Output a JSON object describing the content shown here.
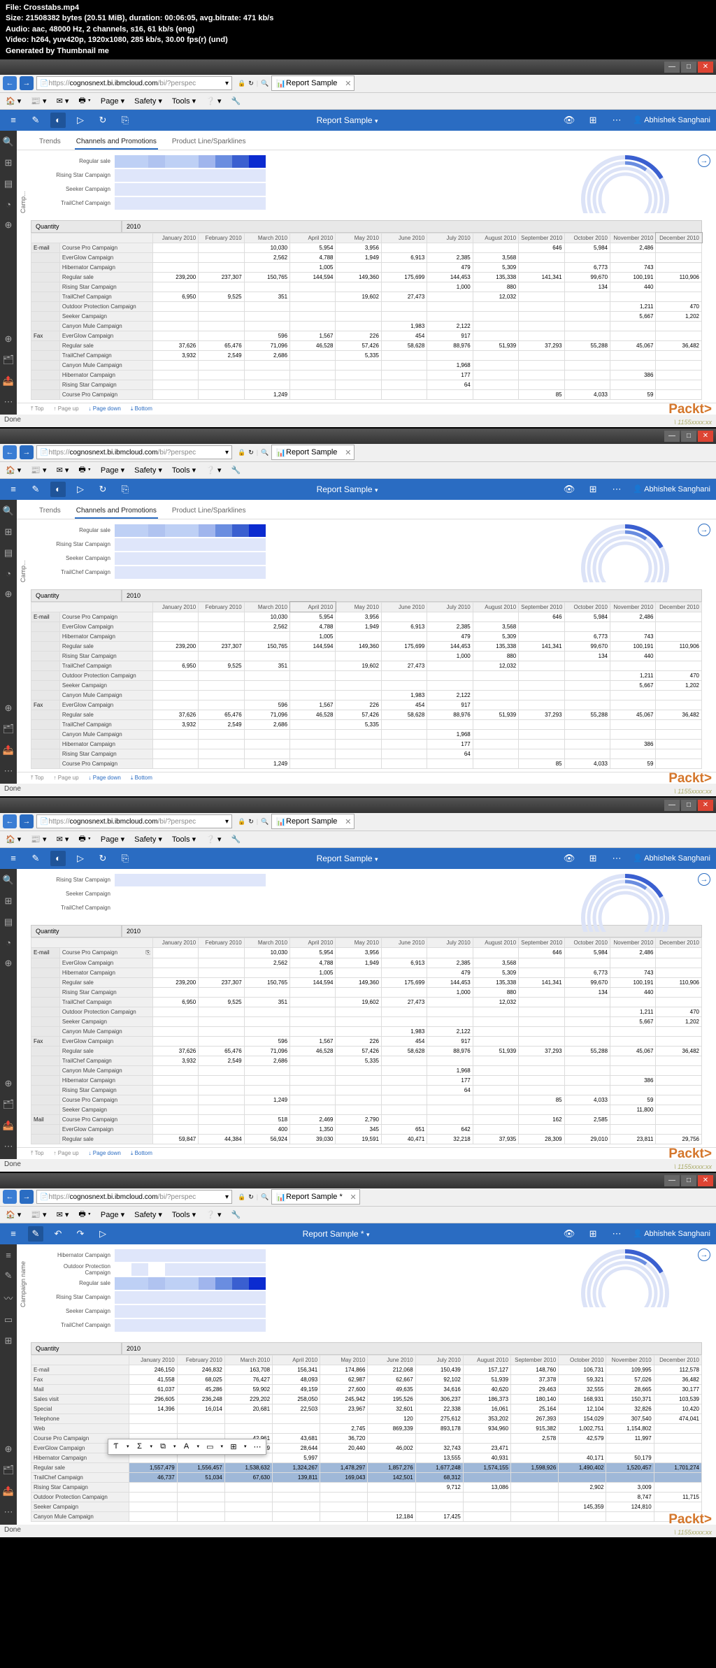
{
  "file_info": {
    "file": "Crosstabs.mp4",
    "size": "21508382 bytes (20.51 MiB), duration: 00:06:05, avg.bitrate: 471 kb/s",
    "audio": "aac, 48000 Hz, 2 channels, s16, 61 kb/s (eng)",
    "video": "h264, yuv420p, 1920x1080, 285 kb/s, 30.00 fps(r) (und)",
    "gen": "Generated by Thumbnail me"
  },
  "browser": {
    "url_proto": "https://",
    "url_host": "cognosnext.bi.ibmcloud.com",
    "url_path": "/bi/?perspec",
    "tab_title": "Report Sample",
    "tab_title_mod": "Report Sample *",
    "menu": {
      "page": "Page",
      "safety": "Safety",
      "tools": "Tools"
    }
  },
  "app": {
    "title": "Report Sample",
    "title_mod": "Report Sample *",
    "user": "Abhishek Sanghani",
    "tabs": {
      "trends": "Trends",
      "channels": "Channels and Promotions",
      "sparklines": "Product Line/Sparklines"
    },
    "rows": [
      "Regular sale",
      "Rising Star Campaign",
      "Seeker Campaign",
      "TrailChef Campaign"
    ],
    "rows4": [
      "Hibernator Campaign",
      "Outdoor Protection Campaign",
      "Regular sale",
      "Rising Star Campaign",
      "Seeker Campaign",
      "TrailChef Campaign"
    ],
    "vlabel": "Camp...",
    "vlabel4": "Campaign name"
  },
  "pager": {
    "top": "Top",
    "pageup": "Page up",
    "pagedown": "Page down",
    "bottom": "Bottom"
  },
  "status": "Done",
  "brand": "Packt",
  "timestamps": [
    "1155xxxx:xx",
    "1155xxxx:xx",
    "1155xxxx:xx",
    "1155xxxx:xx"
  ],
  "table_common": {
    "qty": "Quantity",
    "year": "2010",
    "months": [
      "January 2010",
      "February 2010",
      "March 2010",
      "April 2010",
      "May 2010",
      "June 2010",
      "July 2010",
      "August 2010",
      "September 2010",
      "October 2010",
      "November 2010",
      "December 2010"
    ]
  },
  "table_rows": [
    {
      "cat": "E-mail",
      "name": "Course Pro Campaign",
      "v": [
        "",
        "",
        "10,030",
        "5,954",
        "3,956",
        "",
        "",
        "",
        "646",
        "5,984",
        "2,486",
        ""
      ]
    },
    {
      "cat": "",
      "name": "EverGlow Campaign",
      "v": [
        "",
        "",
        "2,562",
        "4,788",
        "1,949",
        "6,913",
        "2,385",
        "3,568",
        "",
        "",
        "",
        ""
      ]
    },
    {
      "cat": "",
      "name": "Hibernator Campaign",
      "v": [
        "",
        "",
        "",
        "1,005",
        "",
        "",
        "479",
        "5,309",
        "",
        "6,773",
        "743",
        ""
      ]
    },
    {
      "cat": "",
      "name": "Regular sale",
      "v": [
        "239,200",
        "237,307",
        "150,765",
        "144,594",
        "149,360",
        "175,699",
        "144,453",
        "135,338",
        "141,341",
        "99,670",
        "100,191",
        "110,906"
      ]
    },
    {
      "cat": "",
      "name": "Rising Star Campaign",
      "v": [
        "",
        "",
        "",
        "",
        "",
        "",
        "1,000",
        "880",
        "",
        "134",
        "440",
        ""
      ]
    },
    {
      "cat": "",
      "name": "TrailChef Campaign",
      "v": [
        "6,950",
        "9,525",
        "351",
        "",
        "19,602",
        "27,473",
        "",
        "12,032",
        "",
        "",
        "",
        ""
      ]
    },
    {
      "cat": "",
      "name": "Outdoor Protection Campaign",
      "v": [
        "",
        "",
        "",
        "",
        "",
        "",
        "",
        "",
        "",
        "",
        "1,211",
        "470"
      ]
    },
    {
      "cat": "",
      "name": "Seeker Campaign",
      "v": [
        "",
        "",
        "",
        "",
        "",
        "",
        "",
        "",
        "",
        "",
        "5,667",
        "1,202"
      ]
    },
    {
      "cat": "",
      "name": "Canyon Mule Campaign",
      "v": [
        "",
        "",
        "",
        "",
        "",
        "1,983",
        "2,122",
        "",
        "",
        "",
        "",
        ""
      ]
    },
    {
      "cat": "Fax",
      "name": "EverGlow Campaign",
      "v": [
        "",
        "",
        "596",
        "1,567",
        "226",
        "454",
        "917",
        "",
        "",
        "",
        "",
        ""
      ]
    },
    {
      "cat": "",
      "name": "Regular sale",
      "v": [
        "37,626",
        "65,476",
        "71,096",
        "46,528",
        "57,426",
        "58,628",
        "88,976",
        "51,939",
        "37,293",
        "55,288",
        "45,067",
        "36,482"
      ]
    },
    {
      "cat": "",
      "name": "TrailChef Campaign",
      "v": [
        "3,932",
        "2,549",
        "2,686",
        "",
        "5,335",
        "",
        "",
        "",
        "",
        "",
        "",
        ""
      ]
    },
    {
      "cat": "",
      "name": "Canyon Mule Campaign",
      "v": [
        "",
        "",
        "",
        "",
        "",
        "",
        "1,968",
        "",
        "",
        "",
        "",
        ""
      ]
    },
    {
      "cat": "",
      "name": "Hibernator Campaign",
      "v": [
        "",
        "",
        "",
        "",
        "",
        "",
        "177",
        "",
        "",
        "",
        "386",
        ""
      ]
    },
    {
      "cat": "",
      "name": "Rising Star Campaign",
      "v": [
        "",
        "",
        "",
        "",
        "",
        "",
        "64",
        "",
        "",
        "",
        "",
        ""
      ]
    },
    {
      "cat": "",
      "name": "Course Pro Campaign",
      "v": [
        "",
        "",
        "1,249",
        "",
        "",
        "",
        "",
        "",
        "85",
        "4,033",
        "59",
        ""
      ]
    }
  ],
  "table_rows3_extra": [
    {
      "cat": "",
      "name": "Seeker Campaign",
      "v": [
        "",
        "",
        "",
        "",
        "",
        "",
        "",
        "",
        "",
        "",
        "11,800",
        ""
      ]
    },
    {
      "cat": "Mail",
      "name": "Course Pro Campaign",
      "v": [
        "",
        "",
        "518",
        "2,469",
        "2,790",
        "",
        "",
        "",
        "162",
        "2,585",
        "",
        ""
      ]
    },
    {
      "cat": "",
      "name": "EverGlow Campaign",
      "v": [
        "",
        "",
        "400",
        "1,350",
        "345",
        "651",
        "642",
        "",
        "",
        "",
        "",
        ""
      ]
    },
    {
      "cat": "",
      "name": "Regular sale",
      "v": [
        "59,847",
        "44,384",
        "56,924",
        "39,030",
        "19,591",
        "40,471",
        "32,218",
        "37,935",
        "28,309",
        "29,010",
        "23,811",
        "29,756"
      ]
    }
  ],
  "table4": {
    "qty": "Quantity",
    "year": "2010",
    "months": [
      "January 2010",
      "February 2010",
      "March 2010",
      "April 2010",
      "May 2010",
      "June 2010",
      "July 2010",
      "August 2010",
      "September 2010",
      "October 2010",
      "November 2010",
      "December 2010"
    ],
    "top_rows": [
      {
        "name": "E-mail",
        "v": [
          "246,150",
          "246,832",
          "163,708",
          "156,341",
          "174,866",
          "212,068",
          "150,439",
          "157,127",
          "148,760",
          "106,731",
          "109,995",
          "112,578"
        ]
      },
      {
        "name": "Fax",
        "v": [
          "41,558",
          "68,025",
          "76,427",
          "48,093",
          "62,987",
          "62,667",
          "92,102",
          "51,939",
          "37,378",
          "59,321",
          "57,026",
          "36,482"
        ]
      },
      {
        "name": "Mail",
        "v": [
          "61,037",
          "45,286",
          "59,902",
          "49,159",
          "27,600",
          "49,635",
          "34,616",
          "40,620",
          "29,463",
          "32,555",
          "28,665",
          "30,177"
        ]
      },
      {
        "name": "Sales visit",
        "v": [
          "296,605",
          "236,248",
          "229,202",
          "258,050",
          "245,942",
          "195,526",
          "306,237",
          "186,373",
          "180,140",
          "168,931",
          "150,371",
          "103,539"
        ]
      },
      {
        "name": "Special",
        "v": [
          "14,396",
          "16,014",
          "20,681",
          "22,503",
          "23,967",
          "32,601",
          "22,338",
          "16,061",
          "25,164",
          "12,104",
          "32,826",
          "10,420"
        ]
      },
      {
        "name": "Telephone",
        "v": [
          "",
          "",
          "",
          "",
          "",
          "120",
          "275,612",
          "353,202",
          "267,393",
          "154,029",
          "307,540",
          "474,041"
        ]
      },
      {
        "name": "Web",
        "v": [
          "",
          "",
          "",
          "",
          "2,745",
          "869,339",
          "893,178",
          "934,960",
          "915,382",
          "1,002,751",
          "1,154,802",
          ""
        ]
      }
    ],
    "bot_rows": [
      {
        "name": "Course Pro Campaign",
        "v": [
          "",
          "",
          "42,961",
          "43,681",
          "36,720",
          "",
          "",
          "",
          "2,578",
          "42,579",
          "11,997",
          ""
        ]
      },
      {
        "name": "EverGlow Campaign",
        "v": [
          "",
          "",
          "16,129",
          "28,644",
          "20,440",
          "46,002",
          "32,743",
          "23,471",
          "",
          "",
          "",
          ""
        ]
      },
      {
        "name": "Hibernator Campaign",
        "v": [
          "",
          "",
          "",
          "5,997",
          "",
          "",
          "13,555",
          "40,931",
          "",
          "40,171",
          "50,179",
          ""
        ]
      },
      {
        "name": "Regular sale",
        "v": [
          "1,557,479",
          "1,556,457",
          "1,538,632",
          "1,324,267",
          "1,478,297",
          "1,857,276",
          "1,677,248",
          "1,574,155",
          "1,598,926",
          "1,490,402",
          "1,520,457",
          "1,701,274"
        ]
      },
      {
        "name": "TrailChef Campaign",
        "v": [
          "46,737",
          "51,034",
          "67,630",
          "139,811",
          "169,043",
          "142,501",
          "68,312",
          "",
          "",
          "",
          "",
          ""
        ]
      },
      {
        "name": "Rising Star Campaign",
        "v": [
          "",
          "",
          "",
          "",
          "",
          "",
          "9,712",
          "13,086",
          "",
          "2,902",
          "3,009",
          ""
        ]
      },
      {
        "name": "Outdoor Protection Campaign",
        "v": [
          "",
          "",
          "",
          "",
          "",
          "",
          "",
          "",
          "",
          "",
          "8,747",
          "11,715"
        ]
      },
      {
        "name": "Seeker Campaign",
        "v": [
          "",
          "",
          "",
          "",
          "",
          "",
          "",
          "",
          "",
          "145,359",
          "124,810",
          ""
        ]
      },
      {
        "name": "Canyon Mule Campaign",
        "v": [
          "",
          "",
          "",
          "",
          "",
          "12,184",
          "17,425",
          "",
          "",
          "",
          "",
          ""
        ]
      }
    ]
  },
  "heatmap_colors": [
    [
      "#bed0f5",
      "#bed0f5",
      "#b0c3f0",
      "#bed0f5",
      "#bed0f5",
      "#a0b5ed",
      "#6a8de0",
      "#3a5fd0",
      "#0b2bd0"
    ],
    [
      "",
      "",
      "",
      "",
      "",
      "",
      "",
      "",
      ""
    ],
    [
      "",
      "",
      "",
      "",
      "",
      "",
      "",
      "",
      ""
    ],
    [
      "",
      "",
      "",
      "",
      "",
      "",
      "",
      "",
      ""
    ]
  ],
  "heatmap4_colors": [
    [
      "",
      "",
      "",
      "",
      "",
      "",
      "",
      "",
      ""
    ],
    [
      "#fff",
      "",
      "#fff",
      "",
      "",
      "",
      "",
      "",
      ""
    ],
    [
      "#bed0f5",
      "#bed0f5",
      "#b0c3f0",
      "#bed0f5",
      "#bed0f5",
      "#a0b5ed",
      "#6a8de0",
      "#3a5fd0",
      "#0b2bd0"
    ],
    [
      "",
      "",
      "",
      "",
      "",
      "",
      "",
      "",
      ""
    ],
    [
      "",
      "",
      "",
      "",
      "",
      "",
      "",
      "",
      ""
    ],
    [
      "",
      "",
      "",
      "",
      "",
      "",
      "",
      "",
      ""
    ]
  ]
}
